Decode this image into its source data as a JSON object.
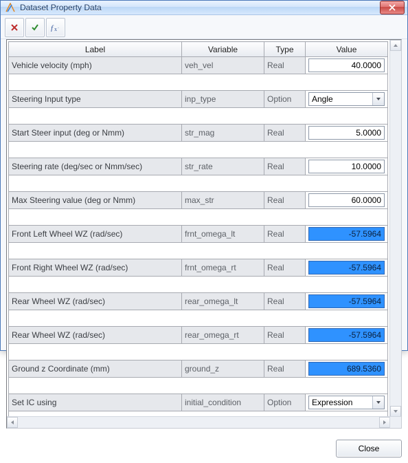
{
  "window": {
    "title": "Dataset Property Data"
  },
  "toolbar": {
    "cancel_tip": "Cancel",
    "apply_tip": "Apply",
    "fx_tip": "Expression"
  },
  "grid": {
    "headers": {
      "label": "Label",
      "variable": "Variable",
      "type": "Type",
      "value": "Value"
    },
    "rows": [
      {
        "label": "Vehicle velocity (mph)",
        "variable": "veh_vel",
        "type": "Real",
        "value": "40.0000",
        "valueKind": "num",
        "hot": false
      },
      {
        "label": "Steering Input type",
        "variable": "inp_type",
        "type": "Option",
        "value": "Angle",
        "valueKind": "combo",
        "hot": false
      },
      {
        "label": "Start Steer input (deg or Nmm)",
        "variable": "str_mag",
        "type": "Real",
        "value": "5.0000",
        "valueKind": "num",
        "hot": false
      },
      {
        "label": "Steering rate (deg/sec or Nmm/sec)",
        "variable": "str_rate",
        "type": "Real",
        "value": "10.0000",
        "valueKind": "num",
        "hot": false
      },
      {
        "label": "Max Steering value (deg or Nmm)",
        "variable": "max_str",
        "type": "Real",
        "value": "60.0000",
        "valueKind": "num",
        "hot": false
      },
      {
        "label": "Front Left Wheel WZ (rad/sec)",
        "variable": "frnt_omega_lt",
        "type": "Real",
        "value": "-57.5964",
        "valueKind": "num",
        "hot": true
      },
      {
        "label": "Front Right Wheel WZ (rad/sec)",
        "variable": "frnt_omega_rt",
        "type": "Real",
        "value": "-57.5964",
        "valueKind": "num",
        "hot": true
      },
      {
        "label": "Rear Wheel WZ (rad/sec)",
        "variable": "rear_omega_lt",
        "type": "Real",
        "value": "-57.5964",
        "valueKind": "num",
        "hot": true
      },
      {
        "label": "Rear Wheel WZ (rad/sec)",
        "variable": "rear_omega_rt",
        "type": "Real",
        "value": "-57.5964",
        "valueKind": "num",
        "hot": true
      },
      {
        "label": "Ground z Coordinate (mm)",
        "variable": "ground_z",
        "type": "Real",
        "value": "689.5360",
        "valueKind": "num",
        "hot": true
      },
      {
        "label": "Set IC using",
        "variable": "initial_condition",
        "type": "Option",
        "value": "Expression",
        "valueKind": "combo",
        "hot": false
      }
    ]
  },
  "footer": {
    "close_label": "Close"
  }
}
